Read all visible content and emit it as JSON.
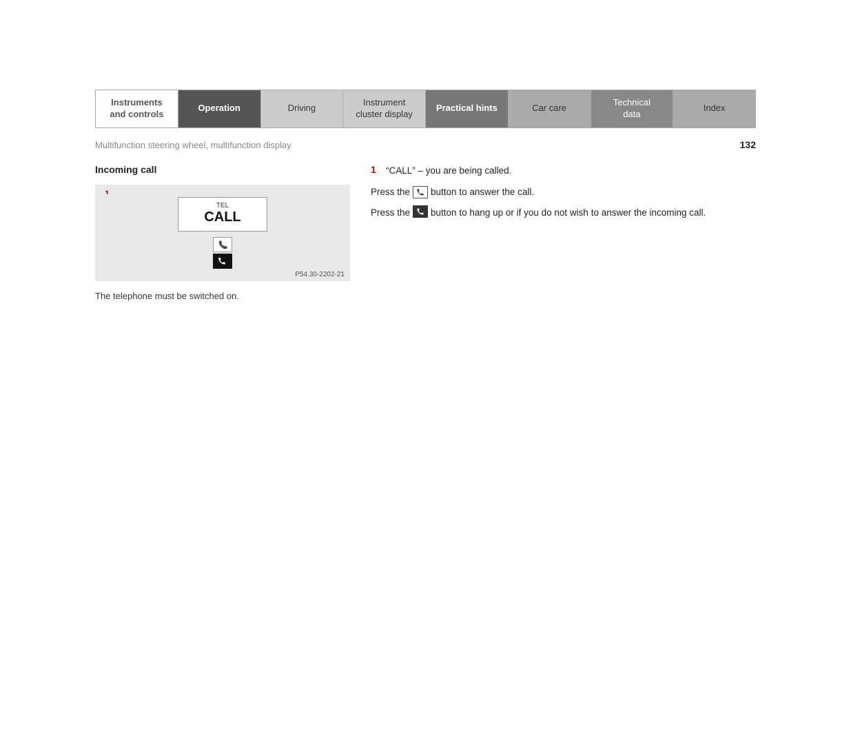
{
  "nav": {
    "tabs": [
      {
        "id": "instruments",
        "label": "Instruments\nand controls",
        "style": "instruments"
      },
      {
        "id": "operation",
        "label": "Operation",
        "style": "active"
      },
      {
        "id": "driving",
        "label": "Driving",
        "style": "driving"
      },
      {
        "id": "instrument-cluster",
        "label": "Instrument\ncluster display",
        "style": "instrument-cluster"
      },
      {
        "id": "practical-hints",
        "label": "Practical hints",
        "style": "practical"
      },
      {
        "id": "car-care",
        "label": "Car care",
        "style": "carcare"
      },
      {
        "id": "technical-data",
        "label": "Technical\ndata",
        "style": "techdata"
      },
      {
        "id": "index",
        "label": "Index",
        "style": "index-tab"
      }
    ]
  },
  "breadcrumb": "Multifunction steering wheel, multifunction display",
  "page_number": "132",
  "section": {
    "title": "Incoming call",
    "diagram_ref": "P54.30-2202-21",
    "diagram_step_number": "1",
    "display_tel": "TEL",
    "display_call": "CALL",
    "note": "The telephone must be switched on."
  },
  "steps": [
    {
      "number": "1",
      "text": "“CALL” – you are being called."
    }
  ],
  "instructions": [
    {
      "text_before": "Press the",
      "icon": "answer",
      "text_after": "button to answer the call."
    },
    {
      "text_before": "Press the",
      "icon": "hangup",
      "text_after": "button to hang up or if you do not wish to answer the incoming call."
    }
  ]
}
